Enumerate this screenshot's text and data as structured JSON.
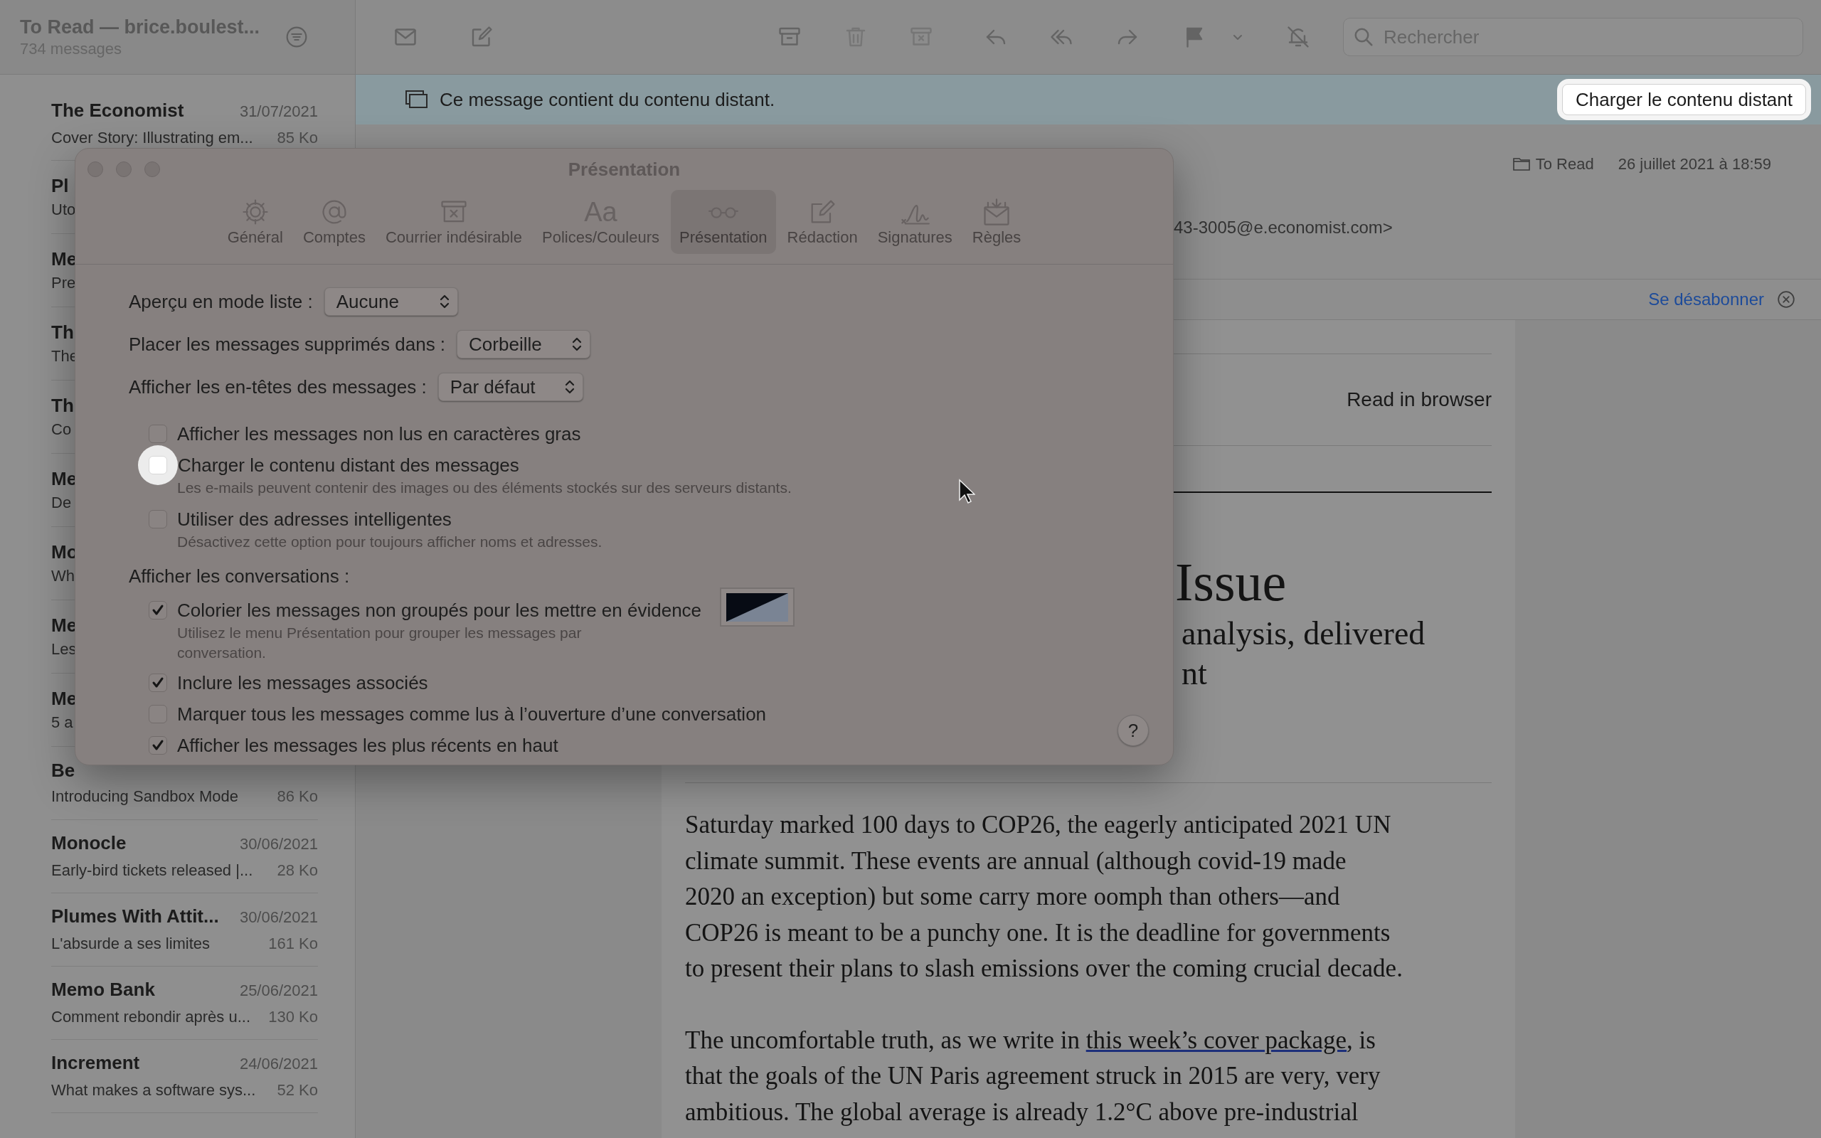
{
  "sidebar": {
    "title": "To Read — brice.boulest...",
    "subtitle": "734 messages",
    "messages": [
      {
        "sender": "The Economist",
        "date": "31/07/2021",
        "preview": "Cover Story: Illustrating em...",
        "size": "85 Ko"
      },
      {
        "sender": "Pl",
        "preview": "Uto"
      },
      {
        "sender": "Me",
        "preview": "Pre"
      },
      {
        "sender": "Th",
        "preview": "The"
      },
      {
        "sender": "Th",
        "preview": "Co"
      },
      {
        "sender": "Me",
        "preview": "De"
      },
      {
        "sender": "Mo",
        "preview": "Wh"
      },
      {
        "sender": "Me",
        "preview": "Les"
      },
      {
        "sender": "Me",
        "preview": "5 a"
      },
      {
        "sender": "Be",
        "preview": "Introducing Sandbox Mode",
        "size": "86 Ko"
      },
      {
        "sender": "Monocle",
        "date": "30/06/2021",
        "preview": "Early-bird tickets released |...",
        "size": "28 Ko"
      },
      {
        "sender": "Plumes With Attit...",
        "date": "30/06/2021",
        "preview": "L'absurde a ses limites",
        "size": "161 Ko"
      },
      {
        "sender": "Memo Bank",
        "date": "25/06/2021",
        "preview": "Comment rebondir après u...",
        "size": "130 Ko"
      },
      {
        "sender": "Increment",
        "date": "24/06/2021",
        "preview": "What makes a software sys...",
        "size": "52 Ko"
      }
    ]
  },
  "toolbar": {
    "search": {
      "placeholder": "Rechercher"
    }
  },
  "banner": {
    "text": "Ce message contient du contenu distant.",
    "button": "Charger le contenu distant",
    "highlighted": true
  },
  "message": {
    "folder": "To Read",
    "date": "26 juillet 2021 à 18:59",
    "from_fragment": "43-3005@e.economist.com>",
    "unsubscribe": "Se désabonner",
    "read_in_browser": "Read in browser",
    "headline_fragment": "Issue",
    "subhead_fragments": [
      "analysis, delivered",
      "nt"
    ],
    "paragraph_1": [
      "Saturday marked 100 days to COP26, the eagerly anticipated 2021 UN",
      "climate summit. These events are annual (although covid-19 made",
      "2020 an exception) but some carry more oomph than others—and",
      "COP26 is meant to be a punchy one. It is the deadline for governments",
      "to present their plans to slash emissions over the coming crucial decade."
    ],
    "paragraph_2": {
      "lead": "The uncomfortable truth, as we write in ",
      "link": "this week’s cover package",
      "rest": [
        ", is",
        "that the goals of the UN Paris agreement struck in 2015 are very, very",
        "ambitious. The global average is already 1.2°C above pre-industrial"
      ]
    }
  },
  "dialog": {
    "title": "Présentation",
    "tabs": [
      {
        "label": "Général",
        "selected": false
      },
      {
        "label": "Comptes",
        "selected": false
      },
      {
        "label": "Courrier indésirable",
        "selected": false
      },
      {
        "label": "Polices/Couleurs",
        "glyph": "Aa",
        "selected": false
      },
      {
        "label": "Présentation",
        "selected": true
      },
      {
        "label": "Rédaction",
        "selected": false
      },
      {
        "label": "Signatures",
        "selected": false
      },
      {
        "label": "Règles",
        "selected": false
      }
    ],
    "popups": [
      {
        "label": "Aperçu en mode liste :",
        "value": "Aucune"
      },
      {
        "label": "Placer les messages supprimés dans :",
        "value": "Corbeille"
      },
      {
        "label": "Afficher les en-têtes des messages :",
        "value": "Par défaut"
      }
    ],
    "options": [
      {
        "label": "Afficher les messages non lus en caractères gras",
        "checked": false,
        "highlighted": false
      },
      {
        "label": "Charger le contenu distant des messages",
        "checked": false,
        "highlighted": true,
        "hint": "Les e-mails peuvent contenir des images ou des éléments stockés sur des serveurs distants."
      },
      {
        "label": "Utiliser des adresses intelligentes",
        "checked": false,
        "highlighted": false,
        "hint": "Désactivez cette option pour toujours afficher noms et adresses."
      }
    ],
    "conversations_label": "Afficher les conversations :",
    "conversation_options": [
      {
        "label": "Colorier les messages non groupés pour les mettre en évidence",
        "checked": true,
        "color_well": true,
        "hint_lines": [
          "Utilisez le menu Présentation pour grouper les messages par",
          "conversation."
        ]
      },
      {
        "label": "Inclure les messages associés",
        "checked": true,
        "color_well": false
      },
      {
        "label": "Marquer tous les messages comme lus à l’ouverture d’une conversation",
        "checked": false,
        "color_well": false
      },
      {
        "label": "Afficher les messages les plus récents en haut",
        "checked": true,
        "color_well": false
      }
    ],
    "help": "?"
  }
}
